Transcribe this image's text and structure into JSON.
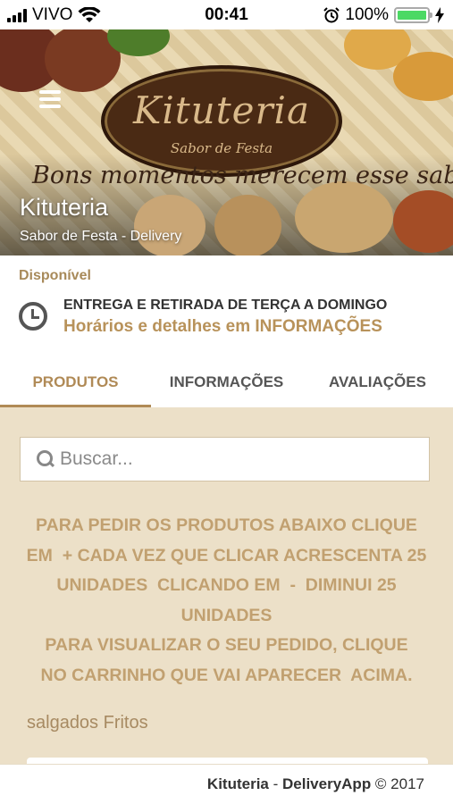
{
  "status_bar": {
    "carrier": "VIVO",
    "time": "00:41",
    "battery": "100%",
    "battery_level": 1.0,
    "icons": [
      "signal-icon",
      "wifi-icon",
      "alarm-icon",
      "battery-icon",
      "charging-icon"
    ]
  },
  "hero": {
    "logo_name": "Kituteria",
    "logo_subtitle": "Sabor de Festa",
    "slogan": "Bons momentos merecem esse sabor!",
    "title": "Kituteria",
    "subtitle": "Sabor de Festa - Delivery"
  },
  "info": {
    "availability": "Disponível",
    "delivery_line": "ENTREGA E RETIRADA DE TERÇA A DOMINGO",
    "hours_link": "Horários e detalhes em INFORMAÇÕES"
  },
  "tabs": [
    {
      "label": "PRODUTOS",
      "active": true
    },
    {
      "label": "INFORMAÇÕES",
      "active": false
    },
    {
      "label": "AVALIAÇÕES",
      "active": false
    }
  ],
  "search": {
    "placeholder": "Buscar...",
    "value": ""
  },
  "notice": {
    "line1": "PARA PEDIR OS PRODUTOS ABAIXO CLIQUE",
    "line2": "EM  + CADA VEZ QUE CLICAR ACRESCENTA 25",
    "line3": "UNIDADES  CLICANDO EM  -  DIMINUI 25",
    "line4": "UNIDADES",
    "line5": "PARA VISUALIZAR O SEU PEDIDO, CLIQUE",
    "line6": "NO CARRINHO QUE VAI APARECER  ACIMA."
  },
  "category": "salgados Fritos",
  "footer": {
    "brand": "Kituteria",
    "separator": " - ",
    "app": "DeliveryApp",
    "copyright": " © 2017"
  },
  "colors": {
    "accent": "#b08a56",
    "background": "#ece0c8",
    "notice_text": "#c1a070",
    "battery_green": "#4cd964"
  }
}
